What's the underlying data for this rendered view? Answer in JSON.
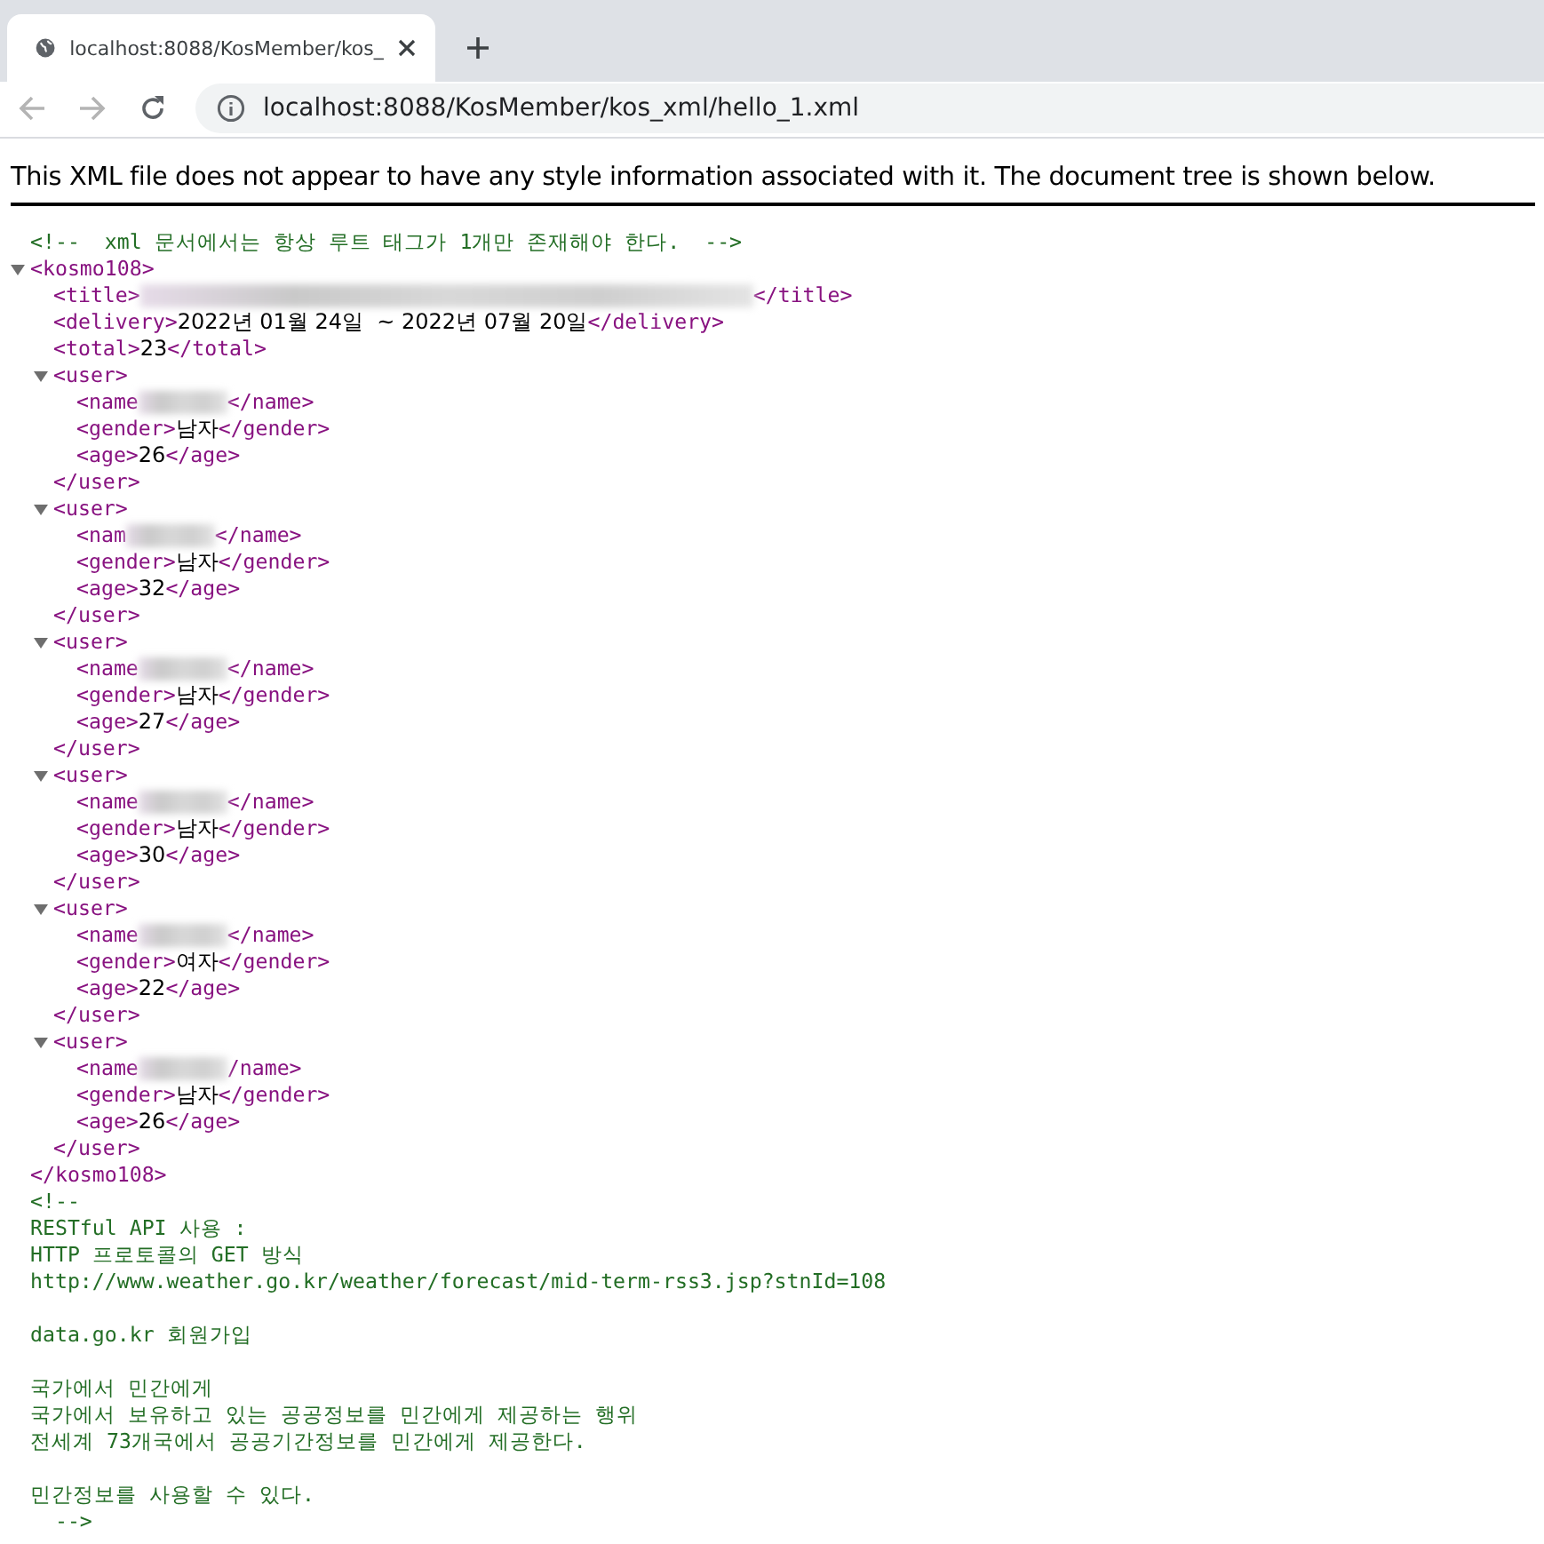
{
  "browser": {
    "tab": {
      "title": "localhost:8088/KosMember/kos_",
      "selected": true
    },
    "address": "localhost:8088/KosMember/kos_xml/hello_1.xml"
  },
  "notice": "This XML file does not appear to have any style information associated with it. The document tree is shown below.",
  "tree": [
    {
      "kind": "comment",
      "text": "<!--  xml 문서에서는 항상 루트 태그가 1개만 존재해야 한다.  -->"
    },
    {
      "kind": "element",
      "open": "<kosmo108>",
      "close": "</kosmo108>",
      "expanded": true,
      "children": [
        {
          "kind": "redacted",
          "open": "<title>",
          "close": "</title>"
        },
        {
          "kind": "leaf",
          "open": "<delivery>",
          "value": "2022년 01월 24일  ~ 2022년 07월 20일",
          "close": "</delivery>"
        },
        {
          "kind": "leaf",
          "open": "<total>",
          "value": "23",
          "close": "</total>"
        },
        {
          "kind": "element",
          "open": "<user>",
          "close": "</user>",
          "expanded": true,
          "children": [
            {
              "kind": "redacted",
              "open": "<name",
              "close": "</name>"
            },
            {
              "kind": "leaf",
              "open": "<gender>",
              "value": "남자",
              "close": "</gender>"
            },
            {
              "kind": "leaf",
              "open": "<age>",
              "value": "26",
              "close": "</age>"
            }
          ]
        },
        {
          "kind": "element",
          "open": "<user>",
          "close": "</user>",
          "expanded": true,
          "children": [
            {
              "kind": "redacted",
              "open": "<nam",
              "close": "</name>"
            },
            {
              "kind": "leaf",
              "open": "<gender>",
              "value": "남자",
              "close": "</gender>"
            },
            {
              "kind": "leaf",
              "open": "<age>",
              "value": "32",
              "close": "</age>"
            }
          ]
        },
        {
          "kind": "element",
          "open": "<user>",
          "close": "</user>",
          "expanded": true,
          "children": [
            {
              "kind": "redacted",
              "open": "<name",
              "close": "</name>"
            },
            {
              "kind": "leaf",
              "open": "<gender>",
              "value": "남자",
              "close": "</gender>"
            },
            {
              "kind": "leaf",
              "open": "<age>",
              "value": "27",
              "close": "</age>"
            }
          ]
        },
        {
          "kind": "element",
          "open": "<user>",
          "close": "</user>",
          "expanded": true,
          "children": [
            {
              "kind": "redacted",
              "open": "<name",
              "close": "</name>"
            },
            {
              "kind": "leaf",
              "open": "<gender>",
              "value": "남자",
              "close": "</gender>"
            },
            {
              "kind": "leaf",
              "open": "<age>",
              "value": "30",
              "close": "</age>"
            }
          ]
        },
        {
          "kind": "element",
          "open": "<user>",
          "close": "</user>",
          "expanded": true,
          "children": [
            {
              "kind": "redacted",
              "open": "<name",
              "close": "</name>"
            },
            {
              "kind": "leaf",
              "open": "<gender>",
              "value": "여자",
              "close": "</gender>"
            },
            {
              "kind": "leaf",
              "open": "<age>",
              "value": "22",
              "close": "</age>"
            }
          ]
        },
        {
          "kind": "element",
          "open": "<user>",
          "close": "</user>",
          "expanded": true,
          "children": [
            {
              "kind": "redacted",
              "open": "<name",
              "close": "/name>"
            },
            {
              "kind": "leaf",
              "open": "<gender>",
              "value": "남자",
              "close": "</gender>"
            },
            {
              "kind": "leaf",
              "open": "<age>",
              "value": "26",
              "close": "</age>"
            }
          ]
        }
      ]
    },
    {
      "kind": "comment",
      "text": "<!--\nRESTful API 사용 :\nHTTP 프로토콜의 GET 방식\nhttp://www.weather.go.kr/weather/forecast/mid-term-rss3.jsp?stnId=108\n\ndata.go.kr 회원가입\n\n국가에서 민간에게\n국가에서 보유하고 있는 공공정보를 민간에게 제공하는 행위\n전세계 73개국에서 공공기간정보를 민간에게 제공한다.\n\n민간정보를 사용할 수 있다.\n  -->"
    }
  ]
}
